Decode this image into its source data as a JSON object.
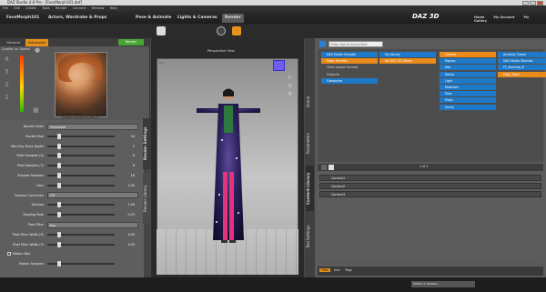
{
  "window": {
    "title": "DAZ Studio 4.6 Pro - [FaceMorph101.duf]"
  },
  "menu": [
    "File",
    "Edit",
    "Create",
    "Tools",
    "Render",
    "Connect",
    "Window",
    "Help"
  ],
  "main_tabs": [
    {
      "label": "FaceMorph101"
    },
    {
      "label": "Actors, Wardrobe & Props"
    },
    {
      "label": "Pose & Animate"
    },
    {
      "label": "Lights & Cameras"
    },
    {
      "label": "Render"
    }
  ],
  "brand": {
    "logo": "DAZ 3D"
  },
  "top_links": [
    "Home",
    "My Account",
    "My Gallery"
  ],
  "left_panel": {
    "tabs": [
      "General",
      "Advanced"
    ],
    "render_button": "Render",
    "quality_label": "Quality vs. Speed",
    "scale": [
      "4",
      "3",
      "2",
      "1"
    ],
    "preview_caption": [
      "Sample Image",
      "Software Render Quality: 4"
    ],
    "settings": [
      {
        "label": "Bucket Order",
        "type": "dropdown",
        "value": "Horizontal"
      },
      {
        "label": "Bucket Size",
        "type": "slider",
        "value": "16",
        "pos": 0.15
      },
      {
        "label": "Max Ray Trace Depth",
        "type": "slider",
        "value": "2",
        "pos": 0.15
      },
      {
        "label": "Pixel Samples (X)",
        "type": "slider",
        "value": "8",
        "pos": 0.15
      },
      {
        "label": "Pixel Samples (Y)",
        "type": "slider",
        "value": "8",
        "pos": 0.15
      },
      {
        "label": "Shadow Samples",
        "type": "slider",
        "value": "16",
        "pos": 0.15
      },
      {
        "label": "Gain",
        "type": "slider",
        "value": "1.00",
        "pos": 0.15
      },
      {
        "label": "Gamma Correction",
        "type": "dropdown",
        "value": "Off"
      },
      {
        "label": "Gamma",
        "type": "slider",
        "value": "1.00",
        "pos": 0.15
      },
      {
        "label": "Shading Rate",
        "type": "slider",
        "value": "0.25",
        "pos": 0.15
      },
      {
        "label": "Pixel Filter",
        "type": "dropdown",
        "value": "Box"
      },
      {
        "label": "Pixel Filter Width (X)",
        "type": "slider",
        "value": "4.00",
        "pos": 0.15
      },
      {
        "label": "Pixel Filter Width (Y)",
        "type": "slider",
        "value": "4.00",
        "pos": 0.15
      },
      {
        "label": "Motion Blur",
        "type": "checkbox"
      },
      {
        "label": "Motion Samples",
        "type": "slider",
        "value": "",
        "pos": 0.15
      }
    ],
    "vertical_tabs": [
      "Render Settings",
      "Render Library"
    ]
  },
  "viewport": {
    "title": "Perspective View",
    "corner_label": "1-3"
  },
  "right_panel": {
    "vertical_tabs": [
      "Scene",
      "Parameters",
      "Content Library",
      "Tool Settings"
    ],
    "search_placeholder": "Enter text to find to filter",
    "columns": [
      {
        "items": [
          {
            "label": "DAZ Studio Formats",
            "state": "blue"
          },
          {
            "label": "Poser Formats",
            "state": "orange"
          },
          {
            "label": "Other Import Formats",
            "state": "plain"
          },
          {
            "label": "Products",
            "state": "plain"
          },
          {
            "label": "Categories",
            "state": "blue"
          }
        ]
      },
      {
        "items": [
          {
            "label": "My Library",
            "state": "blue"
          },
          {
            "label": "My DAZ 3D Library",
            "state": "orange"
          }
        ]
      },
      {
        "items": [
          {
            "label": "Camera",
            "state": "orange"
          },
          {
            "label": "Figures",
            "state": "blue"
          },
          {
            "label": "Hair",
            "state": "blue"
          },
          {
            "label": "Hands",
            "state": "blue"
          },
          {
            "label": "Light",
            "state": "blue"
          },
          {
            "label": "Materials",
            "state": "blue"
          },
          {
            "label": "Pose",
            "state": "blue"
          },
          {
            "label": "Props",
            "state": "blue"
          },
          {
            "label": "Scene",
            "state": "blue"
          }
        ]
      },
      {
        "items": [
          {
            "label": "Alchemy Cream",
            "state": "blue"
          },
          {
            "label": "DAZ Studio Tutorials",
            "state": "blue"
          },
          {
            "label": "FF_Stocking_B",
            "state": "blue"
          },
          {
            "label": "Fixed_Poser",
            "state": "orange"
          }
        ]
      }
    ],
    "page_indicator": "1 of 3",
    "cameras": [
      "Camera1",
      "Camera2",
      "Camera3"
    ],
    "bottom_tabs": [
      "Files",
      "Info",
      "Tags"
    ]
  },
  "status": {
    "lesson_select": "Select a Lesson..."
  }
}
